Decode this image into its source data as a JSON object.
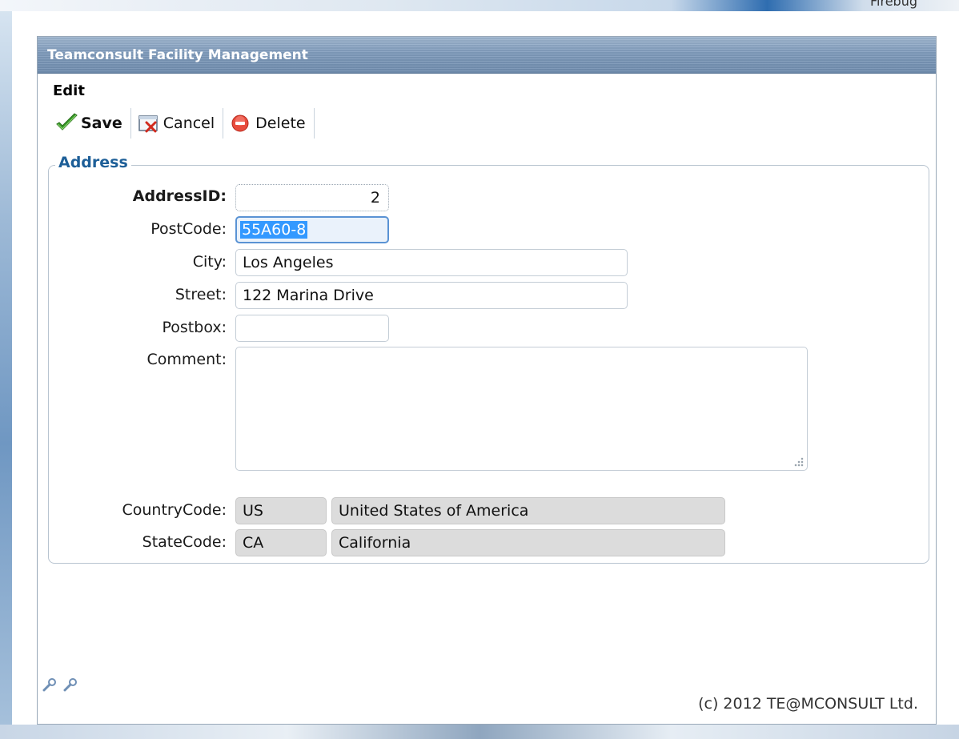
{
  "window": {
    "corner_text": "Firebug"
  },
  "app": {
    "title": "Teamconsult Facility Management"
  },
  "section": {
    "title": "Edit"
  },
  "toolbar": {
    "save_label": "Save",
    "cancel_label": "Cancel",
    "delete_label": "Delete"
  },
  "form": {
    "legend": "Address",
    "fields": {
      "address_id": {
        "label": "AddressID:",
        "value": "2"
      },
      "postcode": {
        "label": "PostCode:",
        "value": "55A60-8"
      },
      "city": {
        "label": "City:",
        "value": "Los Angeles"
      },
      "street": {
        "label": "Street:",
        "value": "122 Marina Drive"
      },
      "postbox": {
        "label": "Postbox:",
        "value": ""
      },
      "comment": {
        "label": "Comment:",
        "value": ""
      },
      "country_code": {
        "label": "CountryCode:",
        "code": "US",
        "name": "United States of America"
      },
      "state_code": {
        "label": "StateCode:",
        "code": "CA",
        "name": "California"
      }
    }
  },
  "footer": {
    "copyright": "(c) 2012 TE@MCONSULT Ltd."
  },
  "icons": {
    "save": "checkmark-icon",
    "cancel": "cancel-icon",
    "delete": "delete-icon",
    "tools": [
      "wrench-icon",
      "wrench-icon"
    ]
  },
  "colors": {
    "titlebar": "#7f9bbb",
    "legend": "#1e5f98",
    "selection": "#3399ff",
    "disabled_field": "#dcdcdc"
  }
}
